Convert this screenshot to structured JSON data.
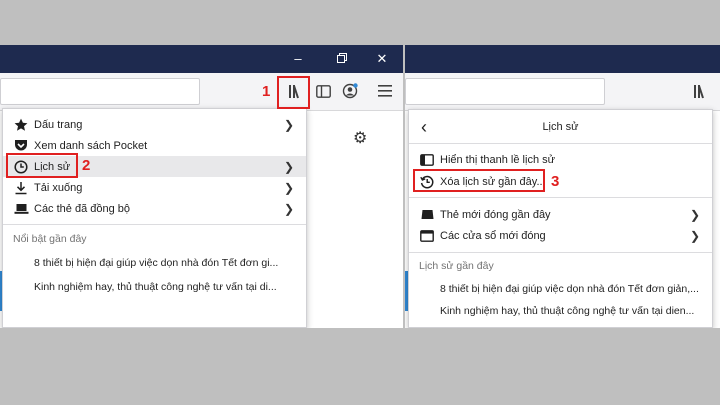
{
  "left": {
    "steps": {
      "one": "1",
      "two": "2"
    },
    "library_menu": {
      "items": [
        {
          "label": "Dấu trang",
          "icon": "star-icon"
        },
        {
          "label": "Xem danh sách Pocket",
          "icon": "pocket-icon"
        },
        {
          "label": "Lịch sử",
          "icon": "clock-icon"
        },
        {
          "label": "Tải xuống",
          "icon": "download-icon"
        },
        {
          "label": "Các thẻ đã đồng bộ",
          "icon": "laptop-icon"
        }
      ],
      "section_title": "Nổi bật gần đây",
      "highlights": [
        "8 thiết bị hiện đại giúp việc dọn nhà đón Tết đơn gi...",
        "Kinh nghiệm hay, thủ thuật công nghệ tư vấn tại di..."
      ]
    }
  },
  "right": {
    "step": "3",
    "history_menu": {
      "back_label": "‹",
      "title": "Lịch sử",
      "items": [
        {
          "label": "Hiển thị thanh lề lịch sử",
          "icon": "sidebar-icon"
        },
        {
          "label": "Xóa lịch sử gần đây...",
          "icon": "history-clear-icon"
        },
        {
          "label": "Thẻ mới đóng gần đây",
          "icon": "tab-icon"
        },
        {
          "label": "Các cửa sổ mới đóng",
          "icon": "window-icon"
        }
      ],
      "section_title": "Lịch sử gần đây",
      "recent": [
        "8 thiết bị hiện đại giúp việc dọn nhà đón Tết đơn giản,...",
        "Kinh nghiệm hay, thủ thuật công nghệ tư vấn tại dien..."
      ]
    }
  },
  "colors": {
    "titlebar": "#1e2a4f",
    "highlight": "#e02020",
    "accent": "#3089d6"
  }
}
